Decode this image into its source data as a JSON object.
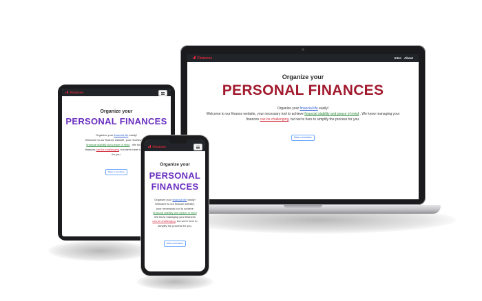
{
  "brand": {
    "name": "Finances",
    "color": "#e0283c"
  },
  "nav_links": [
    "Intro",
    "About"
  ],
  "hero": {
    "subtitle": "Organize your",
    "title": "PERSONAL FINANCES",
    "title_color_desktop": "#a11a2e",
    "title_color_mobile": "#6a2fc0"
  },
  "intro": {
    "part1": "Organize your ",
    "link1": "financial life",
    "part2": " easily!",
    "part3": "Welcome to our finance website, your necessary tool to achieve ",
    "link2": "financial stability and peace of mind",
    "part4": " . We know managing your finances ",
    "link3": "can be challenging",
    "part5": ", but we're here to simplify the process for you."
  },
  "tablet_intro": {
    "line1": "Organize your ",
    "link1": "financial life",
    "line1b": " easily!",
    "line2": "Welcome to our finance website, your necessary to",
    "link2": "financial stability and peace of mind",
    "line3b": " . We know m",
    "line4a": "finances ",
    "link3": "can be challenging",
    "line4b": ", but we're here to simp",
    "line5": "for you."
  },
  "phone_intro": {
    "line1": "Organize your ",
    "link1": "financial life",
    "line1b": " easily!",
    "line2": "Welcome to our finance website,",
    "line3": "your necessary tool to achieve",
    "link2": "financial stability and peace of mind",
    "line5": "We know managing your finances",
    "link3": "can be challenging",
    "line6b": ", but we're here to",
    "line7": "simplify the process for you."
  },
  "cta": {
    "label": "Make a simulation"
  }
}
